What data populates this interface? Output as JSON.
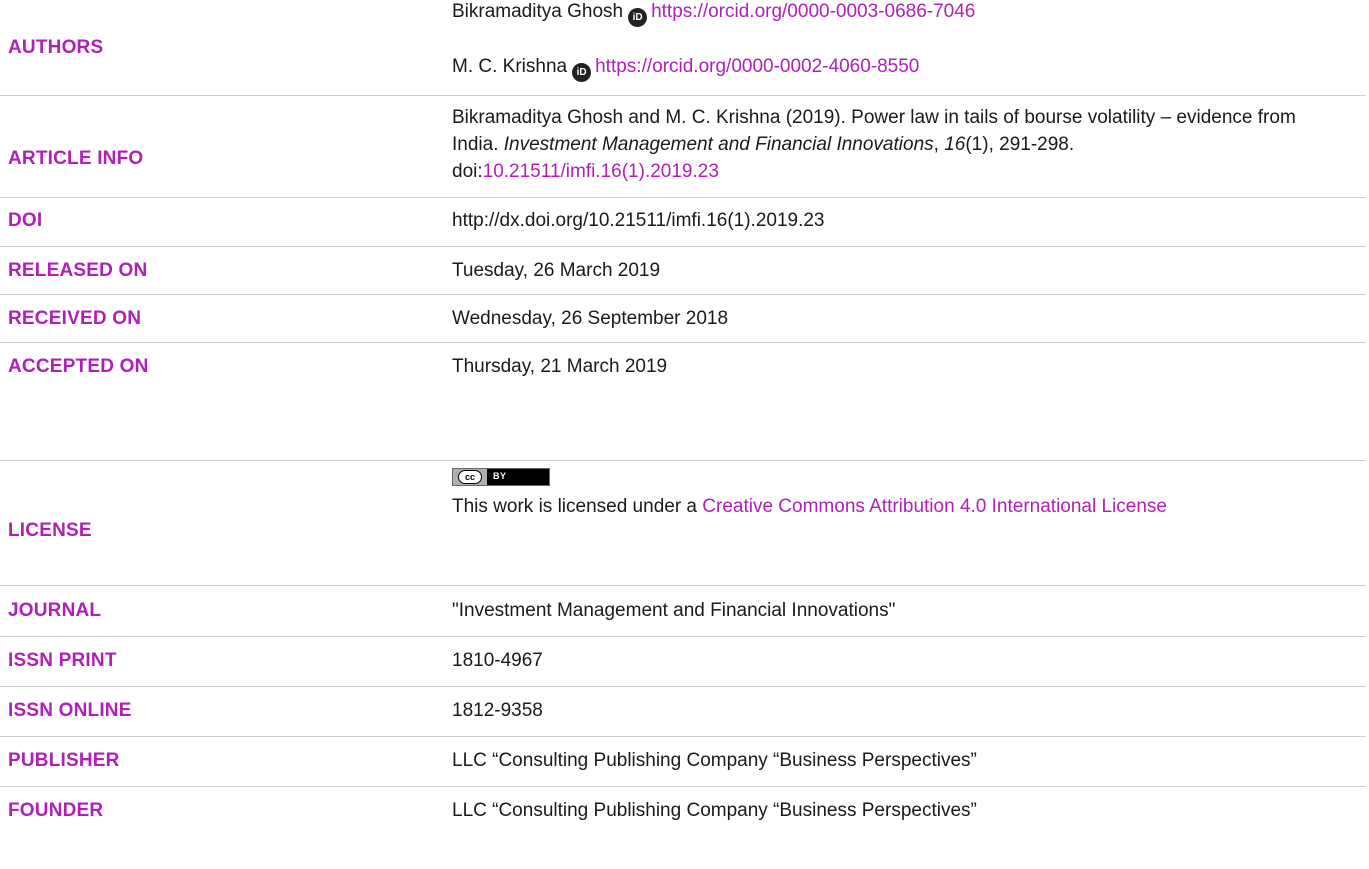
{
  "authors": {
    "label": "AUTHORS",
    "list": [
      {
        "name": "Bikramaditya Ghosh",
        "orcid_icon": "iD",
        "orcid_url": "https://orcid.org/0000-0003-0686-7046"
      },
      {
        "name": "M. C. Krishna",
        "orcid_icon": "iD",
        "orcid_url": "https://orcid.org/0000-0002-4060-8550"
      }
    ]
  },
  "article_info": {
    "label": "ARTICLE INFO",
    "citation_start": "Bikramaditya Ghosh and M. C. Krishna (2019). Power law in tails of bourse volatility – evidence from India. ",
    "journal_italic": "Investment Management and Financial Innovations",
    "comma": ", ",
    "volume_italic": "16",
    "pages": "(1), 291-298. doi:",
    "doi_link": "10.21511/imfi.16(1).2019.23"
  },
  "doi": {
    "label": "DOI",
    "value": "http://dx.doi.org/10.21511/imfi.16(1).2019.23"
  },
  "released": {
    "label": "RELEASED ON",
    "value": "Tuesday, 26 March 2019"
  },
  "received": {
    "label": "RECEIVED ON",
    "value": "Wednesday, 26 September 2018"
  },
  "accepted": {
    "label": "ACCEPTED ON",
    "value": "Thursday, 21 March 2019"
  },
  "license": {
    "label": "LICENSE",
    "badge_cc": "cc",
    "badge_by": "BY",
    "text_before": "This work is licensed under a ",
    "link_text": "Creative Commons Attribution 4.0 International License"
  },
  "journal": {
    "label": "JOURNAL",
    "value": "\"Investment Management and Financial Innovations\""
  },
  "issn_print": {
    "label": "ISSN PRINT",
    "value": "1810-4967"
  },
  "issn_online": {
    "label": "ISSN ONLINE",
    "value": "1812-9358"
  },
  "publisher": {
    "label": "PUBLISHER",
    "value": "LLC “Consulting Publishing Company “Business Perspectives”"
  },
  "founder": {
    "label": "FOUNDER",
    "value": "LLC “Consulting Publishing Company “Business Perspectives”"
  },
  "colors": {
    "label": "#b020b8",
    "link": "#b020b8",
    "text": "#1a1a1a",
    "separator": "#cfcfcf"
  }
}
